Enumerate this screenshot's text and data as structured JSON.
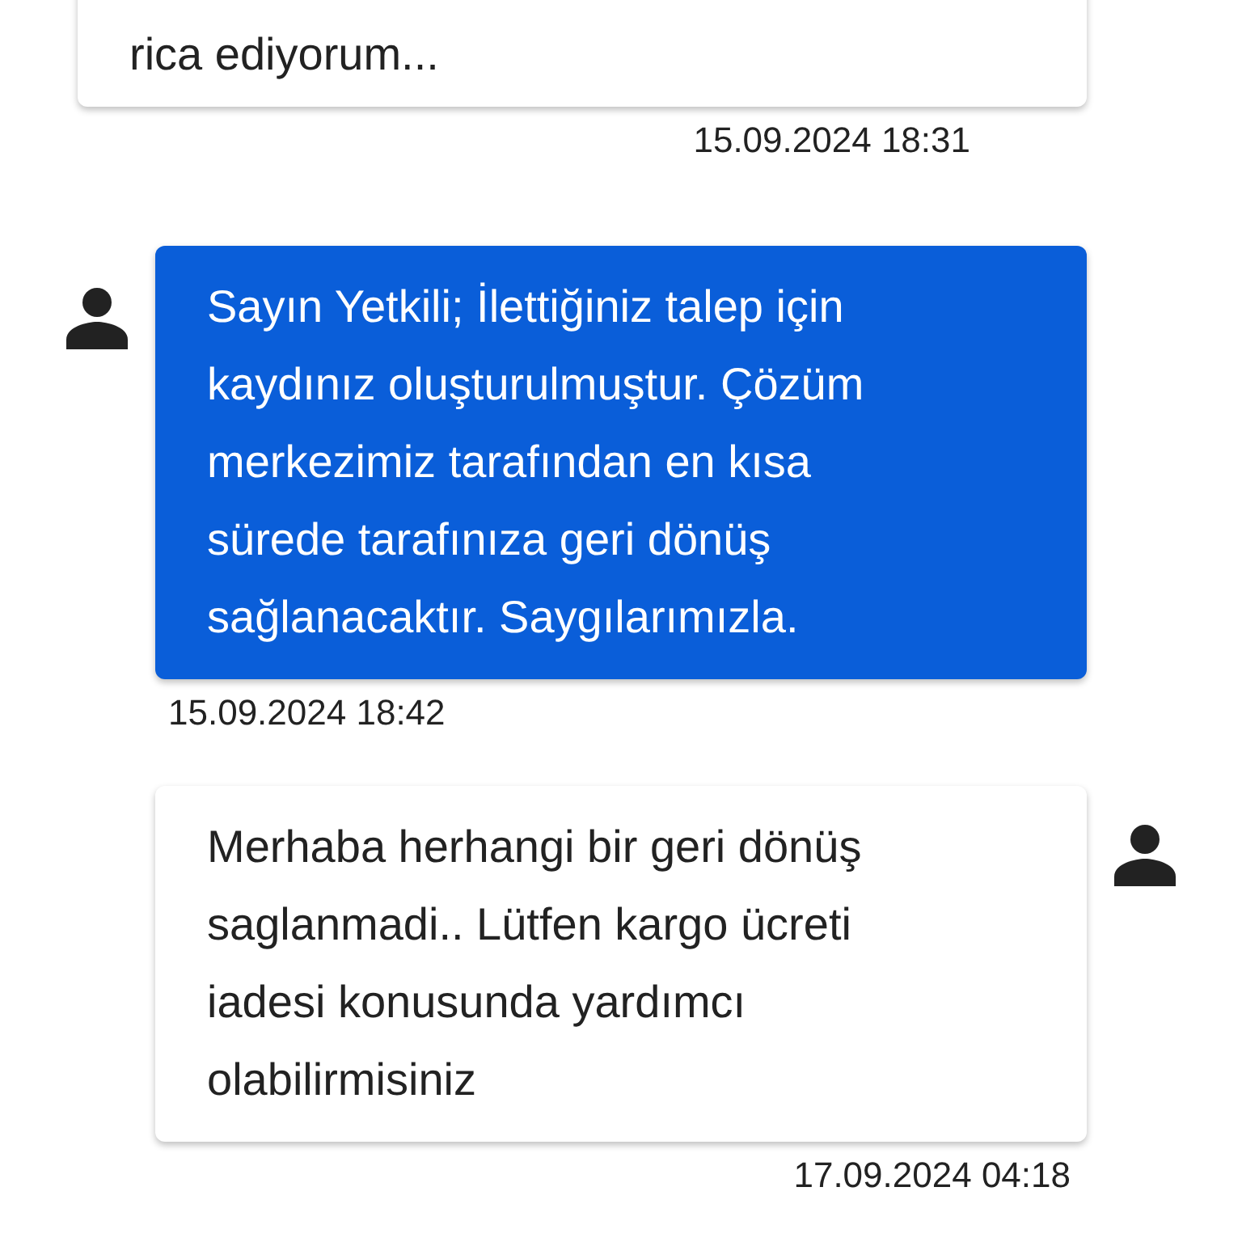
{
  "messages": [
    {
      "kind": "user",
      "cut_top": true,
      "text": "rica ediyorum...",
      "time": "15.09.2024 18:31"
    },
    {
      "kind": "agent",
      "cut_top": false,
      "text": "Sayın Yetkili; İlettiğiniz talep için kaydınız oluşturulmuştur. Çözüm merkezimiz tarafından en kısa sürede tarafınıza geri dönüş sağlanacaktır. Saygılarımızla.",
      "time": "15.09.2024 18:42"
    },
    {
      "kind": "user",
      "cut_top": false,
      "text": "Merhaba herhangi bir geri dönüş saglanmadi.. Lütfen kargo ücreti iadesi konusunda yardımcı olabilirmisiniz",
      "time": "17.09.2024 04:18"
    }
  ]
}
